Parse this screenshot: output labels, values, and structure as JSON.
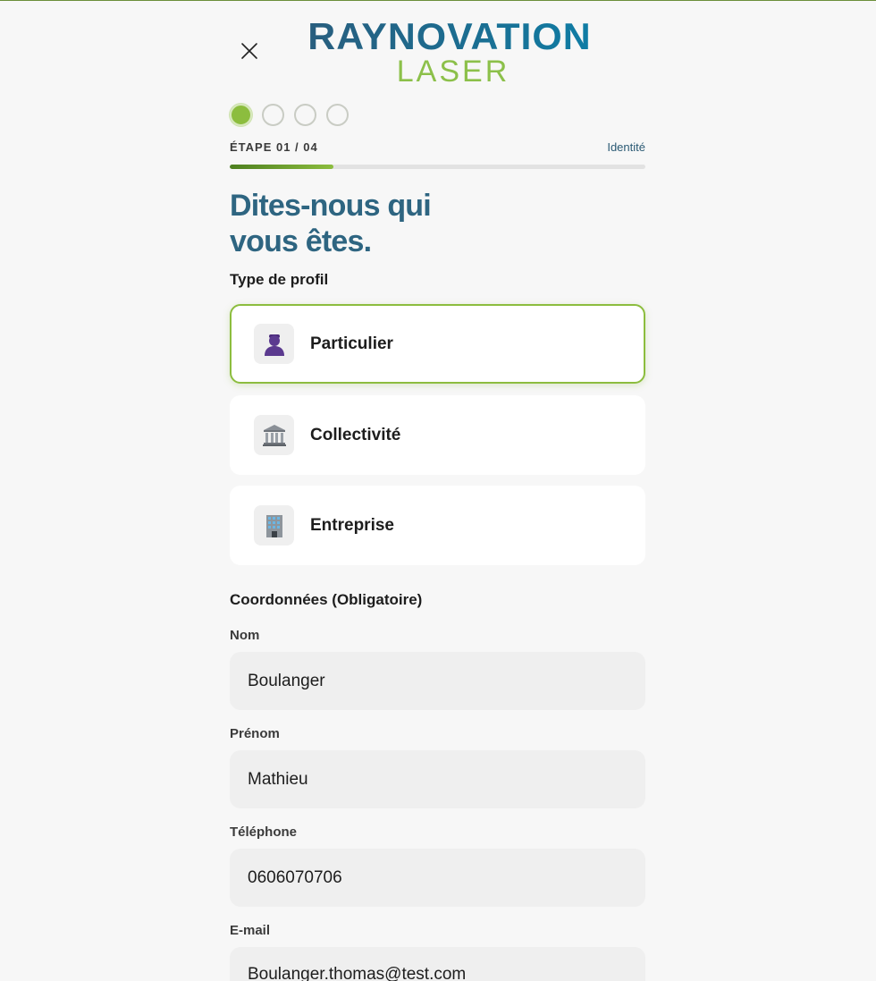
{
  "brand": {
    "name_top": "RAYNOVATION",
    "name_bottom": "LASER"
  },
  "colors": {
    "accent_green": "#8cbd3e",
    "brand_blue": "#2e6581"
  },
  "steps": {
    "total": 4,
    "current": 1,
    "label": "ÉTAPE 01 / 04",
    "current_name": "Identité",
    "progress_fraction": 0.25
  },
  "title": {
    "line1": "Dites-nous qui",
    "line2": "vous êtes."
  },
  "profile": {
    "section_label": "Type de profil",
    "options": [
      {
        "label": "Particulier",
        "icon": "person-icon",
        "selected": true
      },
      {
        "label": "Collectivité",
        "icon": "classical-building-icon",
        "selected": false
      },
      {
        "label": "Entreprise",
        "icon": "office-building-icon",
        "selected": false
      }
    ]
  },
  "contact": {
    "section_label": "Coordonnées (Obligatoire)",
    "fields": {
      "nom": {
        "label": "Nom",
        "value": "Boulanger"
      },
      "prenom": {
        "label": "Prénom",
        "value": "Mathieu"
      },
      "telephone": {
        "label": "Téléphone",
        "value": "0606070706"
      },
      "email": {
        "label": "E-mail",
        "value": "Boulanger.thomas@test.com"
      }
    }
  }
}
